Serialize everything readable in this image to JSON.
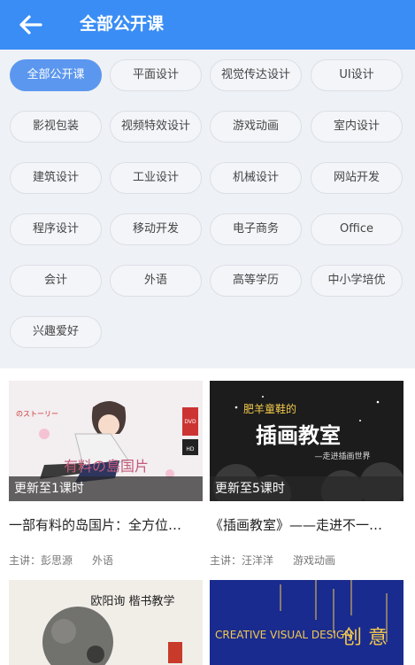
{
  "header": {
    "title": "全部公开课"
  },
  "filters": [
    "全部公开课",
    "平面设计",
    "视觉传达设计",
    "UI设计",
    "影视包装",
    "视频特效设计",
    "游戏动画",
    "室内设计",
    "建筑设计",
    "工业设计",
    "机械设计",
    "网站开发",
    "程序设计",
    "移动开发",
    "电子商务",
    "Office",
    "会计",
    "外语",
    "高等学历",
    "中小学培优",
    "兴趣爱好"
  ],
  "active_filter": "全部公开课",
  "courses": [
    {
      "title": "一部有料的岛国片：全方位…",
      "update": "更新至1课时",
      "teacher": "主讲：彭思源",
      "category": "外语",
      "thumb_text": "有料の島国片"
    },
    {
      "title": "《插画教室》——走进不一…",
      "update": "更新至5课时",
      "teacher": "主讲：汪洋洋",
      "category": "游戏动画",
      "thumb_text": "插画教室",
      "thumb_subtext": "肥羊童鞋的",
      "thumb_caption": "—走进插画世界"
    },
    {
      "thumb_text": "欧阳询 楷书教学"
    },
    {
      "thumb_text": "CREATIVE VISUAL DESIGN",
      "thumb_subtext": "创 意"
    }
  ],
  "colors": {
    "primary": "#3a8df5",
    "chip_active": "#5b97ee",
    "filter_bg": "#eef1f6"
  },
  "icons": {
    "back": "arrow-left-icon"
  }
}
